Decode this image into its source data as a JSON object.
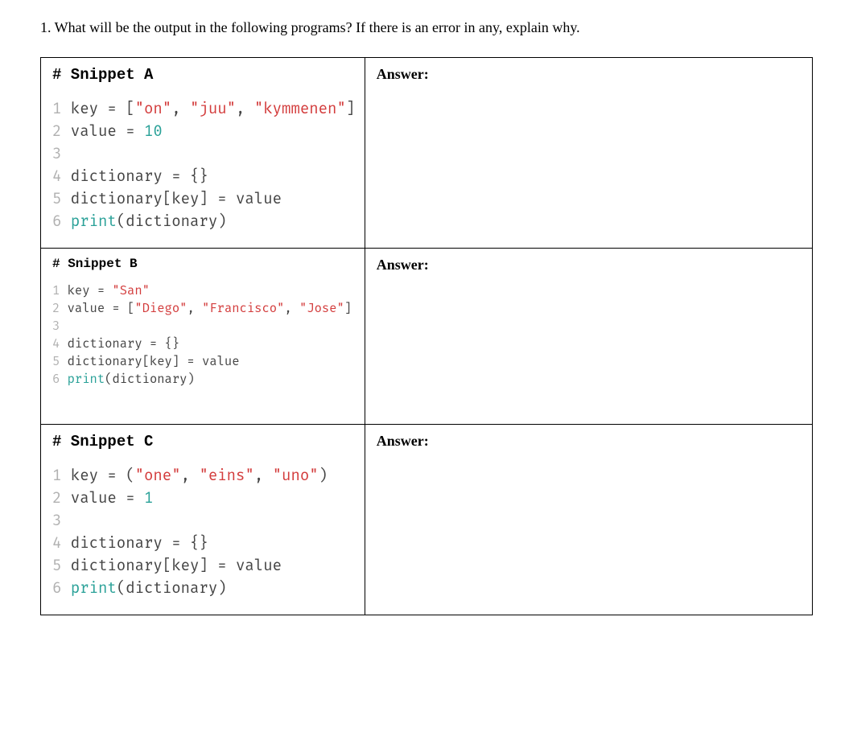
{
  "question": "1. What will be the output in the following programs? If there is an error in any, explain why.",
  "answer_label": "Answer:",
  "snippets": {
    "a": {
      "title": "# Snippet A",
      "size": "large",
      "lines": [
        {
          "n": "1",
          "parts": [
            {
              "t": " key = [",
              "c": "plain"
            },
            {
              "t": "\"on\"",
              "c": "str"
            },
            {
              "t": ", ",
              "c": "plain"
            },
            {
              "t": "\"juu\"",
              "c": "str"
            },
            {
              "t": ", ",
              "c": "plain"
            },
            {
              "t": "\"kymmenen\"",
              "c": "str"
            },
            {
              "t": "]",
              "c": "plain"
            }
          ]
        },
        {
          "n": "2",
          "parts": [
            {
              "t": " value = ",
              "c": "plain"
            },
            {
              "t": "10",
              "c": "num"
            }
          ]
        },
        {
          "n": "3",
          "parts": []
        },
        {
          "n": "4",
          "parts": [
            {
              "t": " dictionary = {}",
              "c": "plain"
            }
          ]
        },
        {
          "n": "5",
          "parts": [
            {
              "t": " dictionary[key] = value",
              "c": "plain"
            }
          ]
        },
        {
          "n": "6",
          "parts": [
            {
              "t": " ",
              "c": "plain"
            },
            {
              "t": "print",
              "c": "kw"
            },
            {
              "t": "(dictionary)",
              "c": "plain"
            }
          ]
        }
      ]
    },
    "b": {
      "title": "# Snippet B",
      "size": "small",
      "lines": [
        {
          "n": "1",
          "parts": [
            {
              "t": " key = ",
              "c": "plain"
            },
            {
              "t": "\"San\"",
              "c": "str"
            }
          ]
        },
        {
          "n": "2",
          "parts": [
            {
              "t": " value = [",
              "c": "plain"
            },
            {
              "t": "\"Diego\"",
              "c": "str"
            },
            {
              "t": ", ",
              "c": "plain"
            },
            {
              "t": "\"Francisco\"",
              "c": "str"
            },
            {
              "t": ", ",
              "c": "plain"
            },
            {
              "t": "\"Jose\"",
              "c": "str"
            },
            {
              "t": "]",
              "c": "plain"
            }
          ]
        },
        {
          "n": "3",
          "parts": []
        },
        {
          "n": "4",
          "parts": [
            {
              "t": " dictionary = {}",
              "c": "plain"
            }
          ]
        },
        {
          "n": "5",
          "parts": [
            {
              "t": " dictionary[key] = value",
              "c": "plain"
            }
          ]
        },
        {
          "n": "6",
          "parts": [
            {
              "t": " ",
              "c": "plain"
            },
            {
              "t": "print",
              "c": "kw"
            },
            {
              "t": "(dictionary)",
              "c": "plain"
            }
          ]
        }
      ]
    },
    "c": {
      "title": "# Snippet C",
      "size": "large",
      "lines": [
        {
          "n": "1",
          "parts": [
            {
              "t": " key = (",
              "c": "plain"
            },
            {
              "t": "\"one\"",
              "c": "str"
            },
            {
              "t": ", ",
              "c": "plain"
            },
            {
              "t": "\"eins\"",
              "c": "str"
            },
            {
              "t": ", ",
              "c": "plain"
            },
            {
              "t": "\"uno\"",
              "c": "str"
            },
            {
              "t": ")",
              "c": "plain"
            }
          ]
        },
        {
          "n": "2",
          "parts": [
            {
              "t": " value = ",
              "c": "plain"
            },
            {
              "t": "1",
              "c": "num"
            }
          ]
        },
        {
          "n": "3",
          "parts": []
        },
        {
          "n": "4",
          "parts": [
            {
              "t": " dictionary = {}",
              "c": "plain"
            }
          ]
        },
        {
          "n": "5",
          "parts": [
            {
              "t": " dictionary[key] = value",
              "c": "plain"
            }
          ]
        },
        {
          "n": "6",
          "parts": [
            {
              "t": " ",
              "c": "plain"
            },
            {
              "t": "print",
              "c": "kw"
            },
            {
              "t": "(dictionary)",
              "c": "plain"
            }
          ]
        }
      ]
    }
  }
}
